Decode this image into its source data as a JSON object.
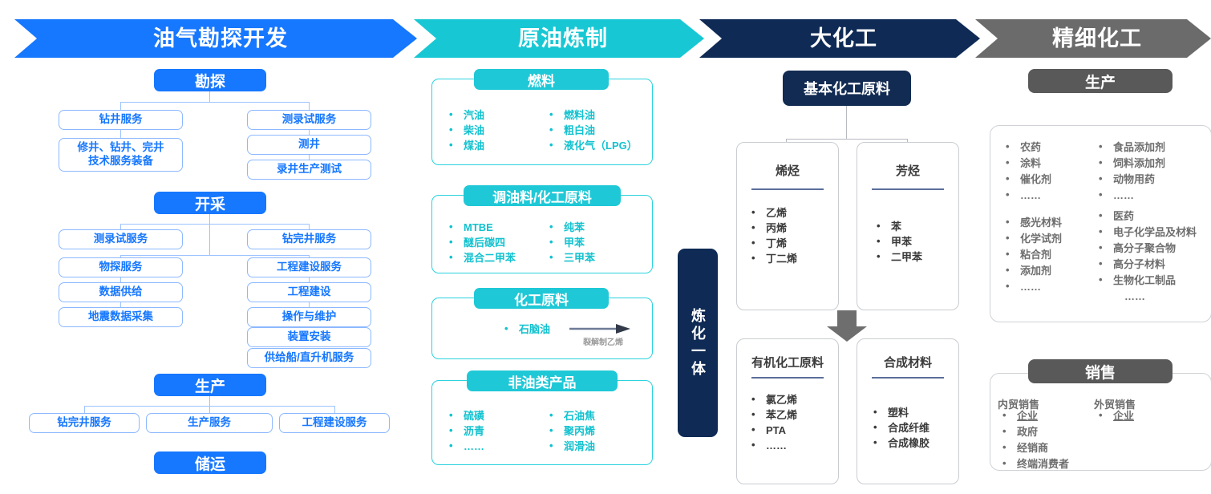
{
  "banners": [
    {
      "label": "油气勘探开发",
      "color": "#1677ff"
    },
    {
      "label": "原油炼制",
      "color": "#17c8d4"
    },
    {
      "label": "大化工",
      "color": "#0e2a55"
    },
    {
      "label": "精细化工",
      "color": "#6b6b6b"
    }
  ],
  "col1": {
    "exploration": {
      "title": "勘探",
      "left": [
        "钻井服务",
        "修井、钻井、完井\n技术服务装备"
      ],
      "left_line1": "修井、钻井、完井",
      "left_line2": "技术服务装备",
      "left_head": "钻井服务",
      "right": [
        "测录试服务",
        "测井",
        "录井生产测试"
      ]
    },
    "extraction": {
      "title": "开采",
      "left_head": "测录试服务",
      "left": [
        "物探服务",
        "数据供给",
        "地震数据采集"
      ],
      "right_head": "钻完井服务",
      "right": [
        "工程建设服务",
        "工程建设",
        "操作与维护",
        "装置安装",
        "供给船/直升机服务"
      ]
    },
    "production": {
      "title": "生产",
      "items": [
        "钻完井服务",
        "生产服务",
        "工程建设服务"
      ]
    },
    "storage": {
      "title": "储运"
    }
  },
  "col2": {
    "fuel": {
      "title": "燃料",
      "left": [
        "汽油",
        "柴油",
        "煤油"
      ],
      "right": [
        "燃料油",
        "粗白油",
        "液化气（LPG）"
      ]
    },
    "blend": {
      "title": "调油料/化工原料",
      "left": [
        "MTBE",
        "醚后碳四",
        "混合二甲苯"
      ],
      "right": [
        "纯苯",
        "甲苯",
        "三甲苯"
      ]
    },
    "chem": {
      "title": "化工原料",
      "item": "石脑油",
      "arrow_label": "裂解制乙烯"
    },
    "nonoil": {
      "title": "非油类产品",
      "left": [
        "硫磺",
        "沥青",
        "……"
      ],
      "right": [
        "石油焦",
        "聚丙烯",
        "润滑油"
      ]
    }
  },
  "vbar": {
    "label": "炼化一体"
  },
  "col3": {
    "head": "基本化工原料",
    "cards": [
      {
        "title": "烯烃",
        "items": [
          "乙烯",
          "丙烯",
          "丁烯",
          "丁二烯"
        ]
      },
      {
        "title": "芳烃",
        "items": [
          "苯",
          "甲苯",
          "二甲苯"
        ]
      },
      {
        "title": "有机化工原料",
        "items": [
          "氯乙烯",
          "苯乙烯",
          "PTA",
          "……"
        ]
      },
      {
        "title": "合成材料",
        "items": [
          "塑料",
          "合成纤维",
          "合成橡胶"
        ]
      }
    ]
  },
  "col4": {
    "production": {
      "title": "生产",
      "col_a_1": [
        "农药",
        "涂料",
        "催化剂",
        "……"
      ],
      "col_b_1": [
        "食品添加剂",
        "饲料添加剂",
        "动物用药",
        "……"
      ],
      "col_a_2": [
        "感光材料",
        "化学试剂",
        "粘合剂",
        "添加剂",
        "……"
      ],
      "col_b_2": [
        "医药",
        "电子化学品及材料",
        "高分子聚合物",
        "高分子材料",
        "生物化工制品"
      ],
      "col_b_2_tail": "……"
    },
    "sales": {
      "title": "销售",
      "domestic_title": "内贸销售",
      "domestic": [
        "企业",
        "政府",
        "经销商",
        "终端消费者"
      ],
      "foreign_title": "外贸销售",
      "foreign": [
        "企业"
      ]
    }
  }
}
